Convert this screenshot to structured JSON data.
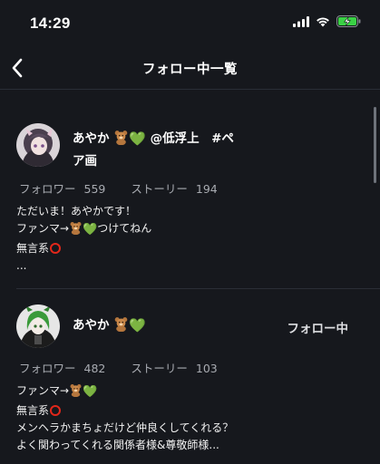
{
  "status_bar": {
    "time": "14:29",
    "battery_color": "#3ad145",
    "icons": [
      "signal-icon",
      "wifi-icon",
      "battery-charging-icon"
    ]
  },
  "nav": {
    "title": "フォロー中一覧",
    "back_icon": "chevron-left-icon"
  },
  "users": [
    {
      "name_line1": "あやか",
      "name_line1_suffix": "@低浮上　#ペ",
      "name_line2": "ア画",
      "follower_label": "フォロワー",
      "follower_count": "559",
      "story_label": "ストーリー",
      "story_count": "194",
      "bio": {
        "line1": "ただいま！あやかです！",
        "line2_prefix": "ファンマ→",
        "line2_suffix": "つけてねん",
        "line3": "無言系",
        "line4": "..."
      }
    },
    {
      "name_line1": "あやか",
      "follow_label": "フォロー中",
      "follower_label": "フォロワー",
      "follower_count": "482",
      "story_label": "ストーリー",
      "story_count": "103",
      "bio": {
        "line1_prefix": "ファンマ→",
        "line2": "無言系",
        "line3": "メンヘラかまちょだけど仲良くしてくれる？",
        "line4": "よく関わってくれる関係者様&尊敬師様..."
      }
    }
  ],
  "emoji": {
    "bear": "teddy-bear-icon",
    "heart": "💚",
    "circle": "red-circle-icon"
  },
  "colors": {
    "background": "#16181d",
    "divider": "#2a2e36",
    "muted_text": "#a8abb1",
    "heart_green": "#45d02d",
    "circle_red": "#e2271a"
  }
}
